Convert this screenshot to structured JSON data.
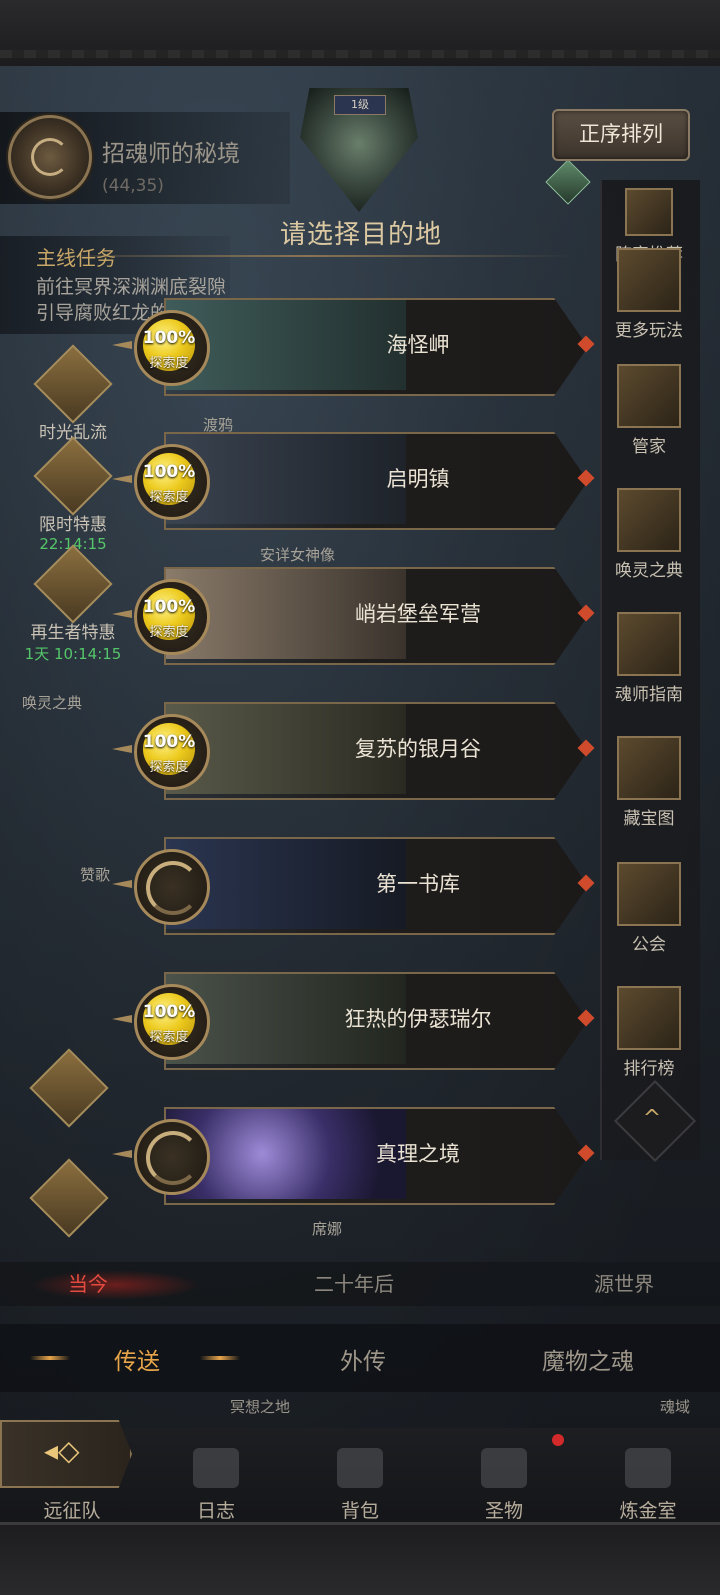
{
  "location": {
    "name": "招魂师的秘境",
    "coords": "(44,35)"
  },
  "boss": {
    "level": "1级"
  },
  "sort_button": "正序排列",
  "destination_title": "请选择目的地",
  "mission": {
    "title": "主线任务",
    "text": "前往冥界深渊渊底裂隙引导腐败红龙的"
  },
  "left_side": [
    {
      "label": "时光乱流",
      "timer": ""
    },
    {
      "label": "限时特惠",
      "timer": "22:14:15"
    },
    {
      "label": "再生者特惠",
      "timer": "1天 10:14:15"
    }
  ],
  "map_labels": [
    "渡鸦",
    "安详女神像",
    "唤灵之典",
    "赞歌",
    "席娜"
  ],
  "destinations": [
    {
      "name": "海怪岬",
      "progress": "100%",
      "progress_label": "探索度",
      "explored": true
    },
    {
      "name": "启明镇",
      "progress": "100%",
      "progress_label": "探索度",
      "explored": true
    },
    {
      "name": "峭岩堡垒军营",
      "progress": "100%",
      "progress_label": "探索度",
      "explored": true
    },
    {
      "name": "复苏的银月谷",
      "progress": "100%",
      "progress_label": "探索度",
      "explored": true
    },
    {
      "name": "第一书库",
      "progress": "",
      "progress_label": "",
      "explored": false
    },
    {
      "name": "狂热的伊瑟瑞尔",
      "progress": "100%",
      "progress_label": "探索度",
      "explored": true
    },
    {
      "name": "真理之境",
      "progress": "",
      "progress_label": "",
      "explored": false
    }
  ],
  "right_menu": [
    "阵容推荐",
    "更多玩法",
    "管家",
    "唤灵之典",
    "魂师指南",
    "藏宝图",
    "公会",
    "排行榜"
  ],
  "eras": [
    "当今",
    "二十年后",
    "源世界"
  ],
  "tabs": [
    "传送",
    "外传",
    "魔物之魂"
  ],
  "sub_labels": [
    "冥想之地",
    "魂域"
  ],
  "nav": [
    "远征队",
    "日志",
    "背包",
    "圣物",
    "炼金室"
  ],
  "colors": {
    "accent_gold": "#c8a767",
    "active_tab": "#e8a54a",
    "active_era": "#e24b3f",
    "timer_green": "#55c56a"
  }
}
